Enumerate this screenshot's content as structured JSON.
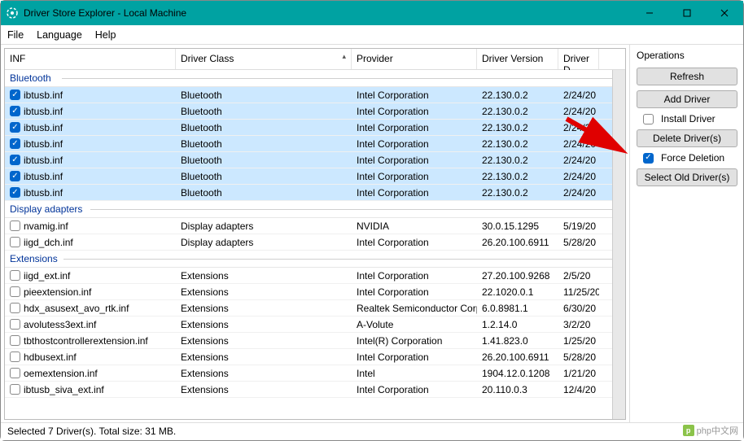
{
  "window": {
    "title": "Driver Store Explorer - Local Machine"
  },
  "menu": {
    "file": "File",
    "language": "Language",
    "help": "Help"
  },
  "columns": {
    "inf": "INF",
    "class": "Driver Class",
    "provider": "Provider",
    "version": "Driver Version",
    "date": "Driver D"
  },
  "groups": {
    "bluetooth": "Bluetooth",
    "display": "Display adapters",
    "extensions": "Extensions"
  },
  "rows": {
    "bt": [
      {
        "inf": "ibtusb.inf",
        "class": "Bluetooth",
        "provider": "Intel Corporation",
        "version": "22.130.0.2",
        "date": "2/24/20"
      },
      {
        "inf": "ibtusb.inf",
        "class": "Bluetooth",
        "provider": "Intel Corporation",
        "version": "22.130.0.2",
        "date": "2/24/20"
      },
      {
        "inf": "ibtusb.inf",
        "class": "Bluetooth",
        "provider": "Intel Corporation",
        "version": "22.130.0.2",
        "date": "2/24/20"
      },
      {
        "inf": "ibtusb.inf",
        "class": "Bluetooth",
        "provider": "Intel Corporation",
        "version": "22.130.0.2",
        "date": "2/24/20"
      },
      {
        "inf": "ibtusb.inf",
        "class": "Bluetooth",
        "provider": "Intel Corporation",
        "version": "22.130.0.2",
        "date": "2/24/20"
      },
      {
        "inf": "ibtusb.inf",
        "class": "Bluetooth",
        "provider": "Intel Corporation",
        "version": "22.130.0.2",
        "date": "2/24/20"
      },
      {
        "inf": "ibtusb.inf",
        "class": "Bluetooth",
        "provider": "Intel Corporation",
        "version": "22.130.0.2",
        "date": "2/24/20"
      }
    ],
    "disp": [
      {
        "inf": "nvamig.inf",
        "class": "Display adapters",
        "provider": "NVIDIA",
        "version": "30.0.15.1295",
        "date": "5/19/20"
      },
      {
        "inf": "iigd_dch.inf",
        "class": "Display adapters",
        "provider": "Intel Corporation",
        "version": "26.20.100.6911",
        "date": "5/28/20"
      }
    ],
    "ext": [
      {
        "inf": "iigd_ext.inf",
        "class": "Extensions",
        "provider": "Intel Corporation",
        "version": "27.20.100.9268",
        "date": "2/5/20"
      },
      {
        "inf": "pieextension.inf",
        "class": "Extensions",
        "provider": "Intel Corporation",
        "version": "22.1020.0.1",
        "date": "11/25/20"
      },
      {
        "inf": "hdx_asusext_avo_rtk.inf",
        "class": "Extensions",
        "provider": "Realtek Semiconductor Corp.",
        "version": "6.0.8981.1",
        "date": "6/30/20"
      },
      {
        "inf": "avolutess3ext.inf",
        "class": "Extensions",
        "provider": "A-Volute",
        "version": "1.2.14.0",
        "date": "3/2/20"
      },
      {
        "inf": "tbthostcontrollerextension.inf",
        "class": "Extensions",
        "provider": "Intel(R) Corporation",
        "version": "1.41.823.0",
        "date": "1/25/20"
      },
      {
        "inf": "hdbusext.inf",
        "class": "Extensions",
        "provider": "Intel Corporation",
        "version": "26.20.100.6911",
        "date": "5/28/20"
      },
      {
        "inf": "oemextension.inf",
        "class": "Extensions",
        "provider": "Intel",
        "version": "1904.12.0.1208",
        "date": "1/21/20"
      },
      {
        "inf": "ibtusb_siva_ext.inf",
        "class": "Extensions",
        "provider": "Intel Corporation",
        "version": "20.110.0.3",
        "date": "12/4/20"
      }
    ]
  },
  "ops": {
    "title": "Operations",
    "refresh": "Refresh",
    "add": "Add Driver",
    "install": "Install Driver",
    "delete": "Delete Driver(s)",
    "force": "Force Deletion",
    "selectold": "Select Old Driver(s)"
  },
  "status": "Selected 7 Driver(s). Total size: 31 MB.",
  "watermark": "php中文网"
}
